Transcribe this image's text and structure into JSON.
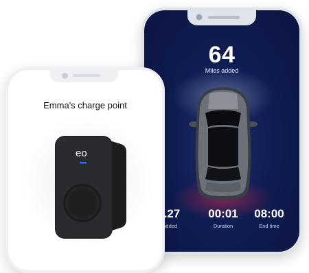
{
  "dark_app": {
    "miles_value": "64",
    "miles_label": "Miles added",
    "stats": [
      {
        "value": "14.27",
        "label": "Wh added"
      },
      {
        "value": "00:01",
        "label": "Duration"
      },
      {
        "value": "08:00",
        "label": "End time"
      }
    ]
  },
  "light_app": {
    "title": "Emma's charge point",
    "brand_logo": "eo"
  },
  "colors": {
    "dark_bg": "#101d52",
    "accent_blue": "#2f6bff"
  }
}
